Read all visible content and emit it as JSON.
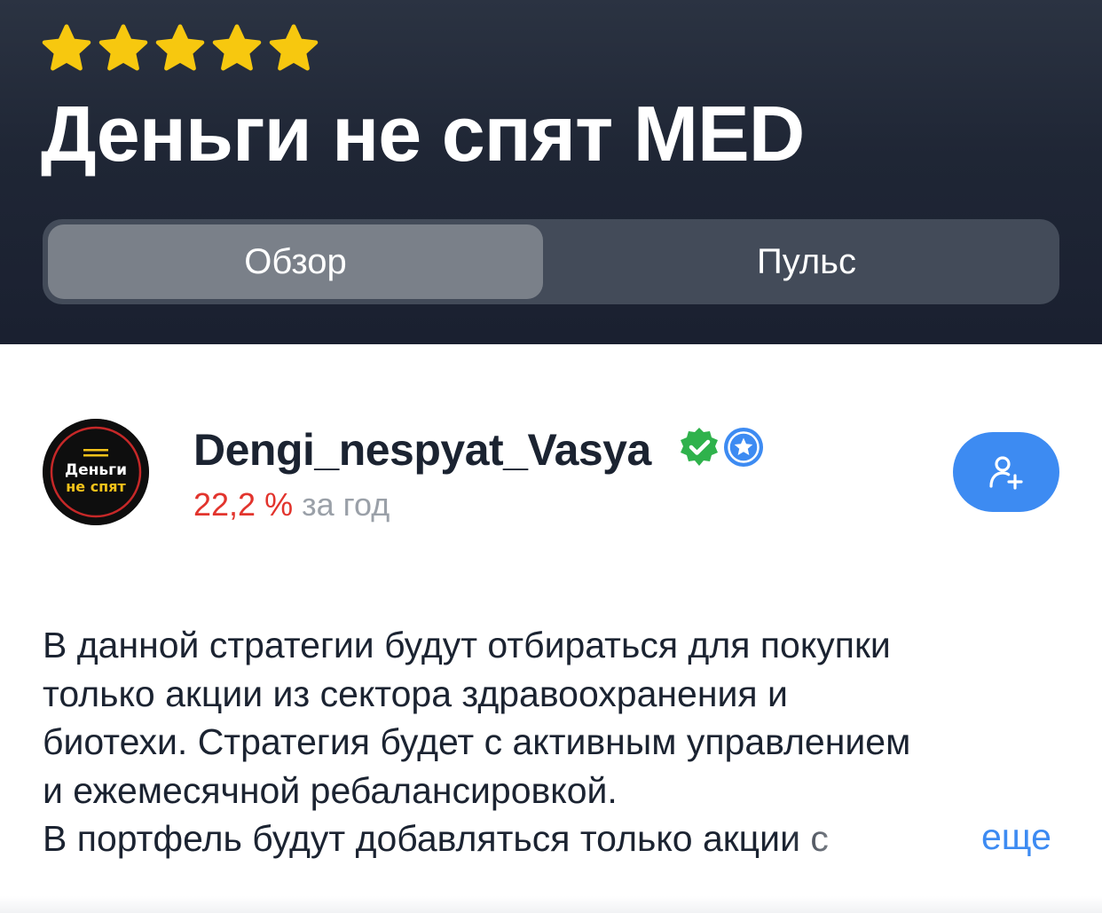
{
  "header": {
    "rating_stars": 5,
    "star_color": "#f7c80f",
    "title": "Деньги не спят MED",
    "background_color": "#1f2635"
  },
  "tabs": [
    {
      "label": "Обзор",
      "active": true
    },
    {
      "label": "Пульс",
      "active": false
    }
  ],
  "author": {
    "avatar_text_top": "Деньги",
    "avatar_text_bottom": "не спят",
    "name": "Dengi_nespyat_Vasya",
    "badges": [
      "verified-check-icon",
      "star-badge-icon"
    ],
    "yield_value": "22,2 %",
    "yield_label": "за год",
    "yield_color": "#e2342d",
    "follow_icon": "add-person-icon",
    "follow_color": "#3d8bf2"
  },
  "description": {
    "lines": [
      "В данной стратегии будут отбираться для покупки",
      "только акции из сектора здравоохранения и",
      "биотехи. Стратегия будет с активным управлением",
      "и ежемесячной ребалансировкой."
    ],
    "last_line": "В портфель будут добавляться только акции с",
    "more_label": "еще"
  }
}
